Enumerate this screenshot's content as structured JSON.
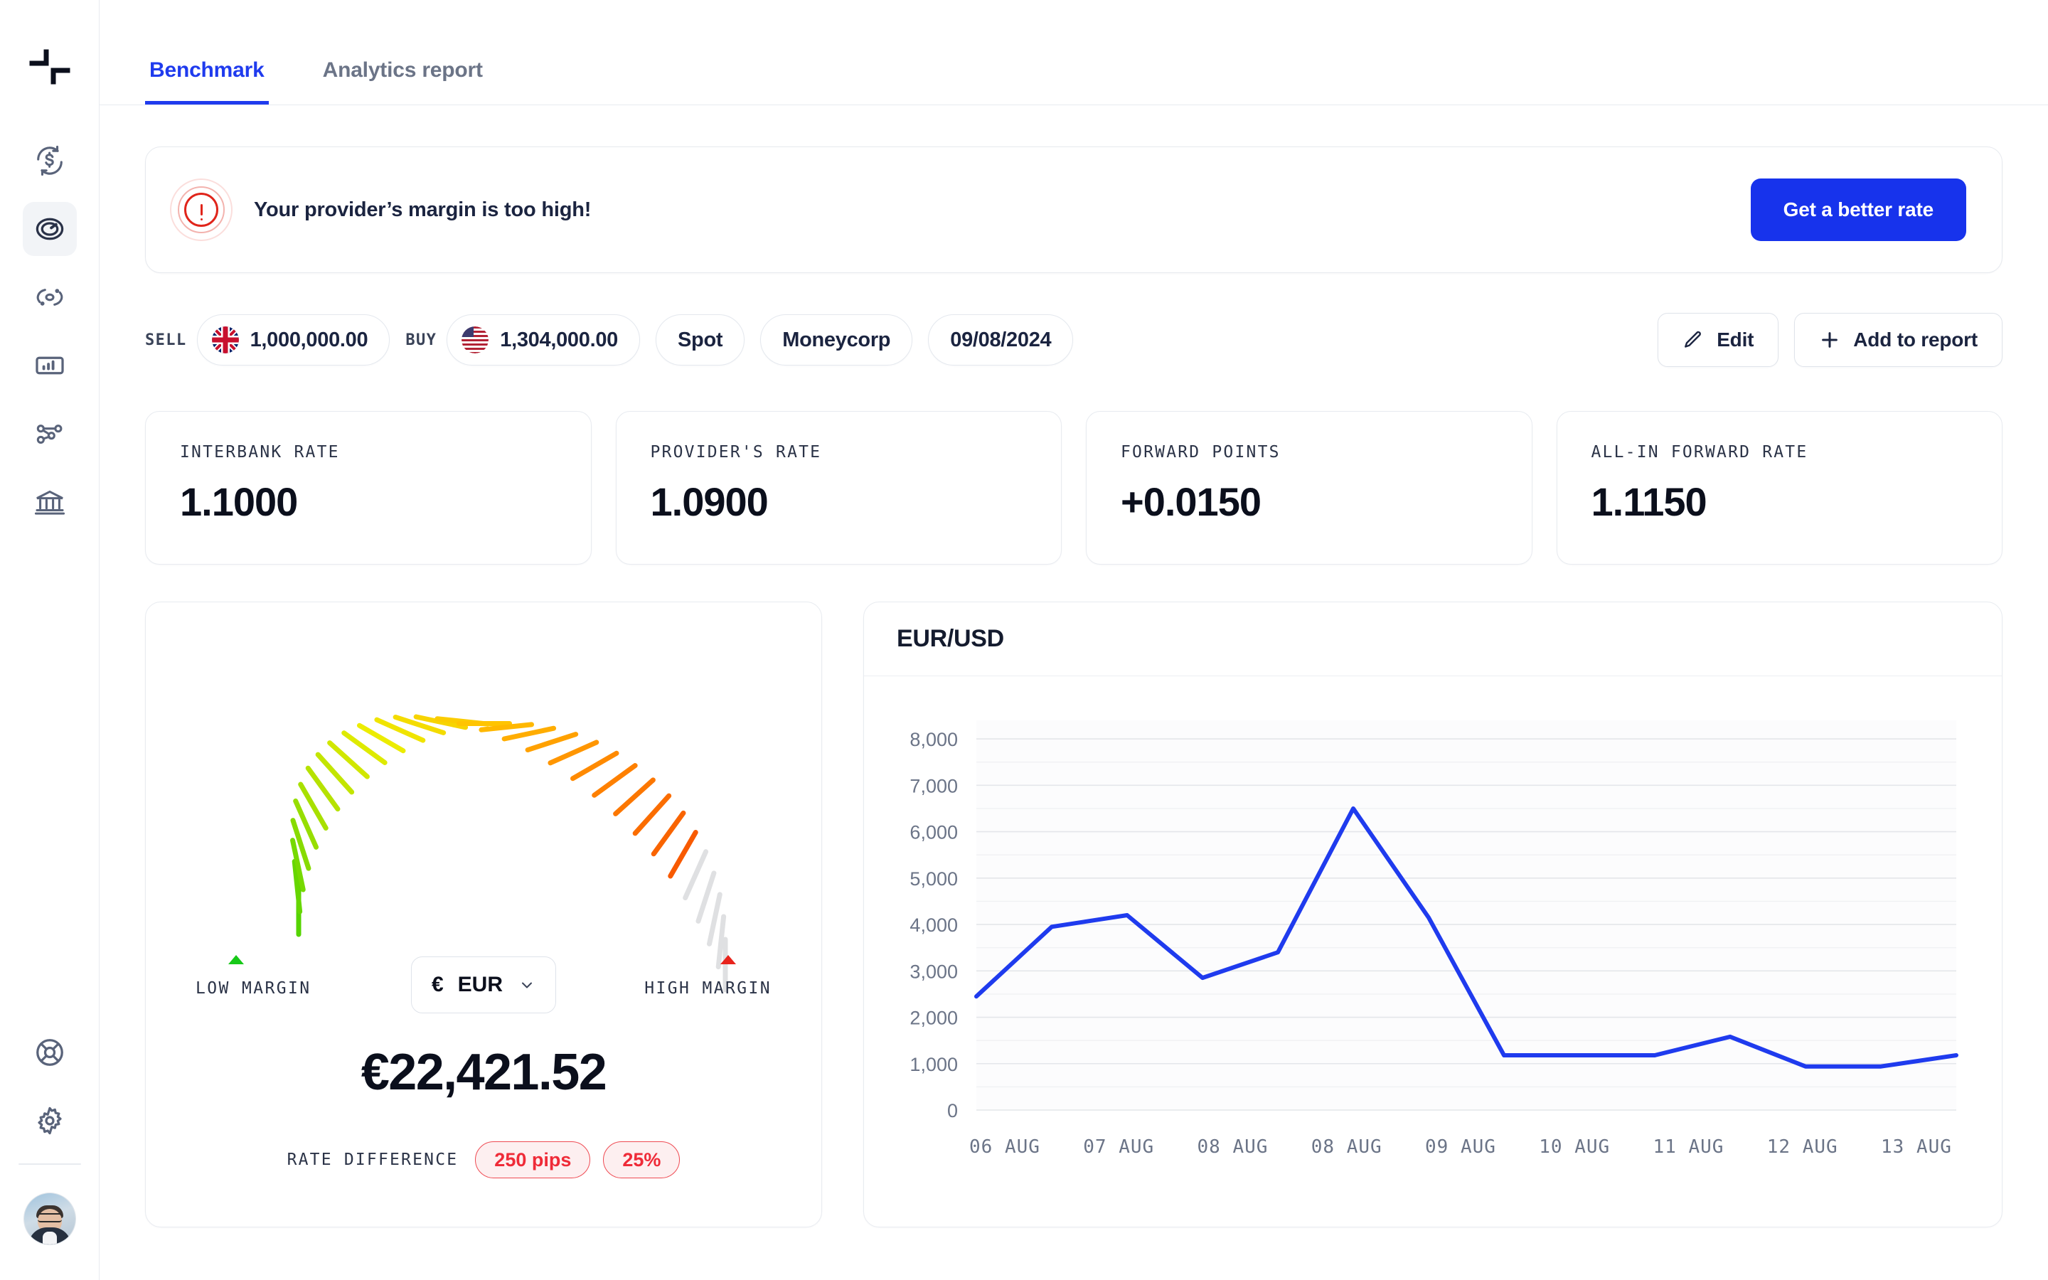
{
  "sidebar": {
    "logo_icon": "brand-logo-icon",
    "items": [
      {
        "name": "currency-exchange",
        "icon": "currency-refresh-icon",
        "active": false
      },
      {
        "name": "benchmark",
        "icon": "speedometer-icon",
        "active": true
      },
      {
        "name": "monitor",
        "icon": "radar-target-icon",
        "active": false
      },
      {
        "name": "reports",
        "icon": "bar-chart-icon",
        "active": false
      },
      {
        "name": "connections",
        "icon": "share-nodes-icon",
        "active": false
      },
      {
        "name": "banks",
        "icon": "bank-icon",
        "active": false
      }
    ],
    "bottom_items": [
      {
        "name": "help",
        "icon": "lifebuoy-icon"
      },
      {
        "name": "settings",
        "icon": "gear-icon"
      }
    ],
    "avatar_alt": "user-avatar"
  },
  "tabs": [
    {
      "label": "Benchmark",
      "active": true
    },
    {
      "label": "Analytics report",
      "active": false
    }
  ],
  "alert": {
    "icon": "alert-circle-icon",
    "message": "Your provider’s margin is too high!",
    "cta_label": "Get a better rate",
    "accent_color": "#1733ec",
    "icon_color": "#e0251b"
  },
  "trade": {
    "sell_label": "SELL",
    "sell_amount": "1,000,000.00",
    "sell_flag": "uk-flag-icon",
    "buy_label": "BUY",
    "buy_amount": "1,304,000.00",
    "buy_flag": "us-flag-icon",
    "type": "Spot",
    "provider": "Moneycorp",
    "date": "09/08/2024",
    "edit_label": "Edit",
    "edit_icon": "pencil-icon",
    "add_label": "Add to report",
    "add_icon": "plus-icon"
  },
  "metrics": [
    {
      "label": "INTERBANK RATE",
      "value": "1.1000"
    },
    {
      "label": "PROVIDER'S RATE",
      "value": "1.0900"
    },
    {
      "label": "FORWARD POINTS",
      "value": "+0.0150"
    },
    {
      "label": "ALL-IN FORWARD RATE",
      "value": "1.1150"
    }
  ],
  "gauge": {
    "low_label": "LOW MARGIN",
    "high_label": "HIGH MARGIN",
    "currency_symbol": "€",
    "currency_code": "EUR",
    "chevron_icon": "chevron-down-icon",
    "amount": "€22,421.52",
    "rate_difference_label": "RATE DIFFERENCE",
    "pips_badge": "250 pips",
    "percent_badge": "25%",
    "total_ticks": 31,
    "active_ticks": 26,
    "inactive_color": "#dfe0e2",
    "low_marker_color": "#17c918",
    "high_marker_color": "#e8241c",
    "gradient_stops": [
      "#55d400",
      "#a8e000",
      "#ecec00",
      "#ffc400",
      "#ff8a00",
      "#f85a00"
    ]
  },
  "chart_data": {
    "type": "line",
    "title": "EUR/USD",
    "xlabel": "",
    "ylabel": "",
    "grid": true,
    "legend": "none",
    "line_color": "#1f3bee",
    "categories": [
      "06 AUG",
      "07 AUG",
      "08 AUG",
      "08 AUG",
      "09 AUG",
      "10 AUG",
      "11 AUG",
      "12 AUG",
      "13 AUG"
    ],
    "x": [
      0,
      1,
      2,
      3,
      4,
      5,
      6,
      7,
      8,
      9,
      10,
      11,
      12,
      13,
      14,
      15,
      16
    ],
    "values": [
      2450,
      3950,
      4200,
      2850,
      3400,
      6500,
      4150,
      1180,
      1180,
      1180,
      1580,
      940,
      940,
      1180
    ],
    "ylim": [
      0,
      8400
    ],
    "yticks": [
      0,
      1000,
      2000,
      3000,
      4000,
      5000,
      6000,
      7000,
      8000
    ],
    "ytick_labels": [
      "0",
      "1,000",
      "2,000",
      "3,000",
      "4,000",
      "5,000",
      "6,000",
      "7,000",
      "8,000"
    ],
    "minor_gridline_step": 500
  }
}
